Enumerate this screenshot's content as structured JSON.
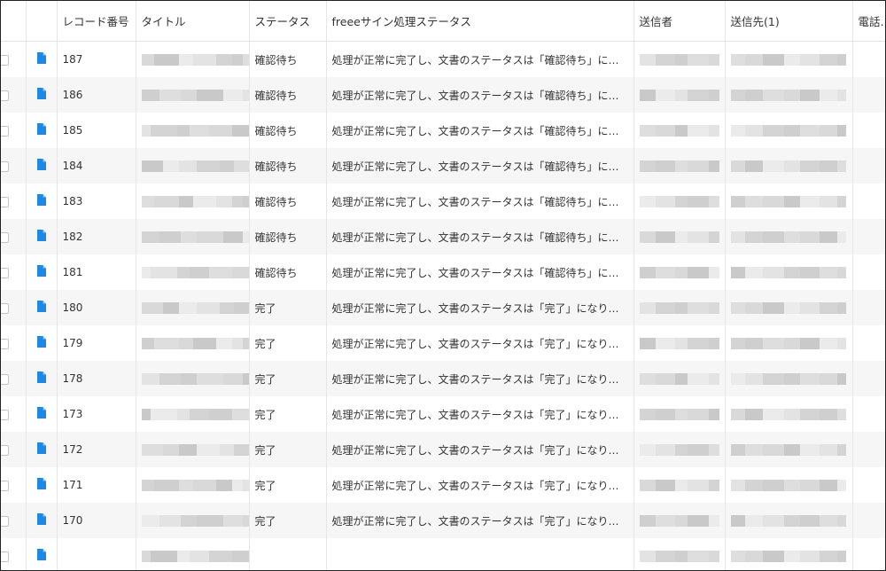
{
  "columns": {
    "record_no": "レコード番号",
    "title": "タイトル",
    "status": "ステータス",
    "freee_status": "freeeサイン処理ステータス",
    "sender": "送信者",
    "recipient": "送信先(1)",
    "phone": "電話番号"
  },
  "icons": {
    "row_icon": "document-icon"
  },
  "colors": {
    "doc_icon": "#1e88e5",
    "row_alt": "#f6f6f6"
  },
  "rows": [
    {
      "no": "187",
      "status": "確認待ち",
      "freee_status": "処理が正常に完了し、文書のステータスは「確認待ち」になりました"
    },
    {
      "no": "186",
      "status": "確認待ち",
      "freee_status": "処理が正常に完了し、文書のステータスは「確認待ち」になりました"
    },
    {
      "no": "185",
      "status": "確認待ち",
      "freee_status": "処理が正常に完了し、文書のステータスは「確認待ち」になりました"
    },
    {
      "no": "184",
      "status": "確認待ち",
      "freee_status": "処理が正常に完了し、文書のステータスは「確認待ち」になりました"
    },
    {
      "no": "183",
      "status": "確認待ち",
      "freee_status": "処理が正常に完了し、文書のステータスは「確認待ち」になりました"
    },
    {
      "no": "182",
      "status": "確認待ち",
      "freee_status": "処理が正常に完了し、文書のステータスは「確認待ち」になりました"
    },
    {
      "no": "181",
      "status": "確認待ち",
      "freee_status": "処理が正常に完了し、文書のステータスは「確認待ち」になりました"
    },
    {
      "no": "180",
      "status": "完了",
      "freee_status": "処理が正常に完了し、文書のステータスは「完了」になりました。"
    },
    {
      "no": "179",
      "status": "完了",
      "freee_status": "処理が正常に完了し、文書のステータスは「完了」になりました。"
    },
    {
      "no": "178",
      "status": "完了",
      "freee_status": "処理が正常に完了し、文書のステータスは「完了」になりました。"
    },
    {
      "no": "173",
      "status": "完了",
      "freee_status": "処理が正常に完了し、文書のステータスは「完了」になりました。"
    },
    {
      "no": "172",
      "status": "完了",
      "freee_status": "処理が正常に完了し、文書のステータスは「完了」になりました。"
    },
    {
      "no": "171",
      "status": "完了",
      "freee_status": "処理が正常に完了し、文書のステータスは「完了」になりました。"
    },
    {
      "no": "170",
      "status": "完了",
      "freee_status": "処理が正常に完了し、文書のステータスは「完了」になりました。"
    },
    {
      "no": "",
      "status": "",
      "freee_status": ""
    }
  ]
}
